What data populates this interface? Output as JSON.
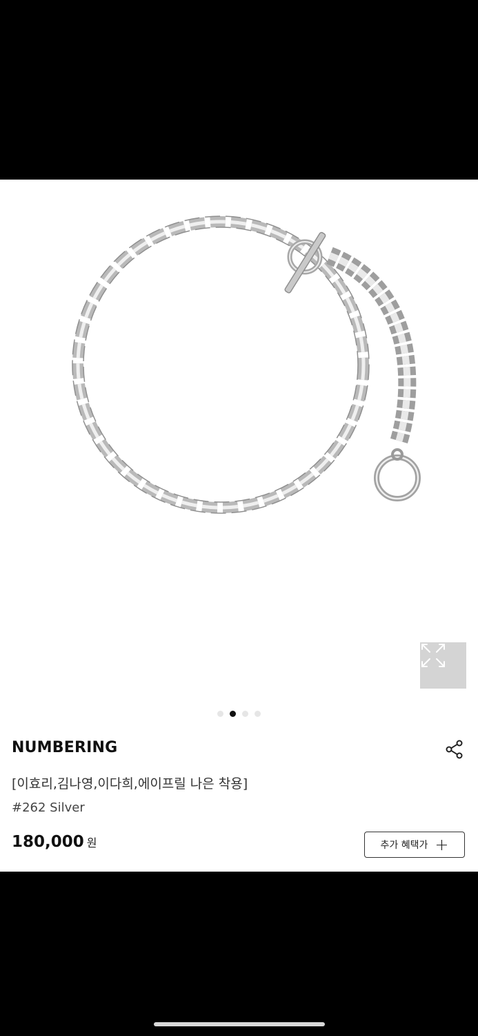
{
  "product": {
    "brand": "NUMBERING",
    "title": "[이효리,김나영,이다희,에이프릴 나은 착용]",
    "option": "#262 Silver",
    "price": "180,000",
    "currency": "원"
  },
  "gallery": {
    "image_icon": "silver-chain-bracelet-image",
    "zoom_icon": "expand-arrows-icon",
    "slide_count": 4,
    "active_slide": 2
  },
  "actions": {
    "share_icon": "share-icon",
    "benefit_label": "추가 혜택가",
    "benefit_icon": "plus-icon"
  },
  "colors": {
    "background": "#000000",
    "card": "#ffffff",
    "text": "#111111",
    "zoom_bg": "#d4d4d4"
  }
}
